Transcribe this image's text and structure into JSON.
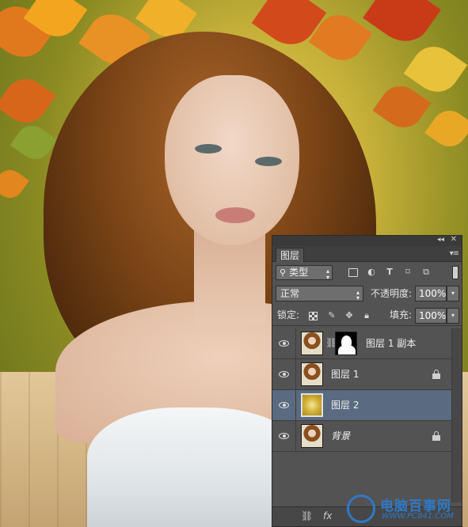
{
  "panel": {
    "tab_label": "图层",
    "filter": {
      "label": "类型",
      "icons": [
        "image-filter-icon",
        "adjustment-filter-icon",
        "type-filter-icon",
        "shape-filter-icon",
        "smart-object-filter-icon"
      ]
    },
    "blend_mode": "正常",
    "opacity_label": "不透明度:",
    "opacity_value": "100%",
    "lock_label": "锁定:",
    "fill_label": "填充:",
    "fill_value": "100%",
    "layers": [
      {
        "name": "图层 1 副本",
        "visible": true,
        "has_mask": true,
        "locked": false,
        "selected": false
      },
      {
        "name": "图层 1",
        "visible": true,
        "has_mask": false,
        "locked": true,
        "selected": false
      },
      {
        "name": "图层 2",
        "visible": true,
        "has_mask": false,
        "locked": false,
        "selected": true
      },
      {
        "name": "背景",
        "visible": true,
        "has_mask": false,
        "locked": true,
        "selected": false
      }
    ],
    "bottom_icons": [
      "link-layers-icon",
      "fx-icon"
    ],
    "fx_label": "fx"
  },
  "watermark": {
    "title": "电脑百事网",
    "url": "WWW.PC841.COM"
  },
  "colors": {
    "panel_bg": "#535353",
    "selected_row": "#5a6a80",
    "watermark_blue": "#2f78c7"
  }
}
